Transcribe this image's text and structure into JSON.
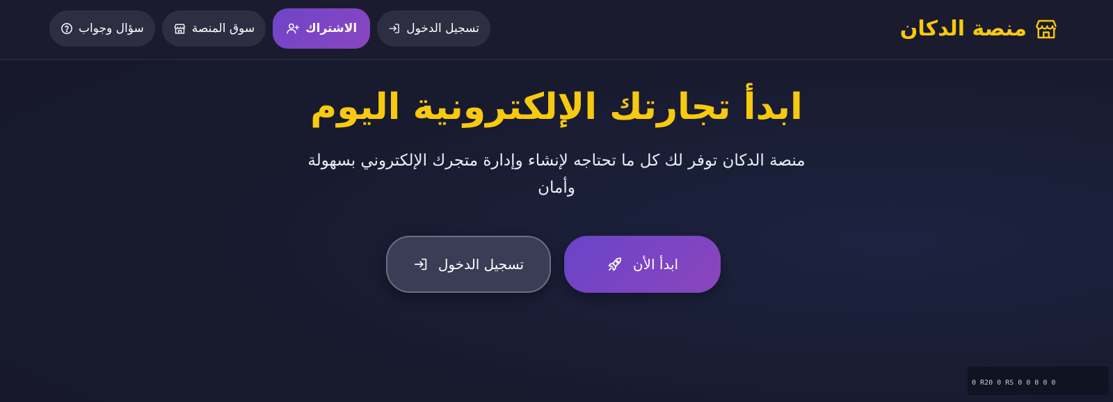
{
  "header": {
    "brand": {
      "name": "منصة الدكان",
      "icon": "store-icon",
      "color": "#f7c90f"
    },
    "nav": [
      {
        "label": "تسجيل الدخول",
        "icon": "login-icon"
      },
      {
        "label": "الاشتراك",
        "icon": "user-plus-icon",
        "highlighted": true
      },
      {
        "label": "سوق المنصة",
        "icon": "store-icon"
      },
      {
        "label": "سؤال وجواب",
        "icon": "question-circle-icon"
      }
    ]
  },
  "hero": {
    "title": "ابدأ تجارتك الإلكترونية اليوم",
    "subtitle": "منصة الدكان توفر لك كل ما تحتاجه لإنشاء وإدارة متجرك الإلكتروني بسهولة وأمان",
    "buttons": {
      "start": {
        "label": "ابدأ الأن",
        "icon": "rocket-icon"
      },
      "login": {
        "label": "تسجيل الدخول",
        "icon": "login-icon"
      }
    }
  },
  "status": {
    "text": "0 R20 0 RS 0 0 0 0 0"
  },
  "colors": {
    "accent_yellow": "#f7c90f",
    "accent_purple": "#7b45c4",
    "background": "#181a2e",
    "button_dark": "#2d2e42"
  }
}
